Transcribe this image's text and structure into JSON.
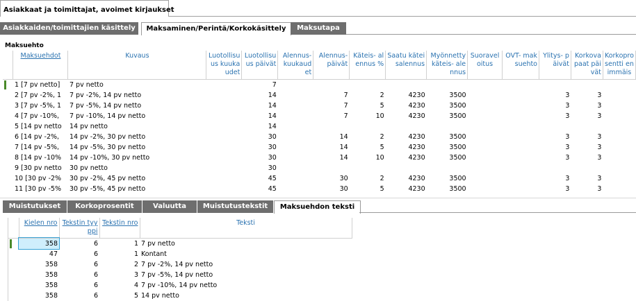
{
  "window": {
    "title": "Asiakkaat ja toimittajat, avoimet kirjaukset"
  },
  "top_tabs": [
    {
      "label": "Asiakkaiden/toimittajien käsittely",
      "active": false
    },
    {
      "label": "Maksaminen/Perintä/Korkokäsittely",
      "active": true
    },
    {
      "label": "Maksutapa",
      "active": false
    }
  ],
  "section_title": "Maksuehto",
  "grid1": {
    "columns": [
      "Maksuehdot",
      "Kuvaus",
      "Luotollisuus kuukaudet",
      "Luotollisuus päivät",
      "Alennus- kuukaudet",
      "Alennus- päivät",
      "Käteis- alennus %",
      "Saatu käteisalennus",
      "Myönnetty käteis- alennus",
      "Suoraveloitus",
      "OVT- maksuehto",
      "Ylitys- päivät",
      "Korkovapaat päivät",
      "Korkoprosentti enimmäis"
    ],
    "rows": [
      [
        "1 [7 pv netto]",
        "7 pv netto",
        "",
        "7",
        "",
        "",
        "",
        "",
        "",
        "",
        "",
        "",
        "",
        ""
      ],
      [
        "2 [7 pv -2%, 1",
        "7 pv -2%, 14 pv netto",
        "",
        "14",
        "",
        "7",
        "2",
        "4230",
        "3500",
        "",
        "",
        "3",
        "3",
        ""
      ],
      [
        "3 [7 pv -5%, 1",
        "7 pv -5%, 14 pv netto",
        "",
        "14",
        "",
        "7",
        "5",
        "4230",
        "3500",
        "",
        "",
        "3",
        "3",
        ""
      ],
      [
        "4 [7 pv -10%,",
        "7 pv -10%, 14 pv netto",
        "",
        "14",
        "",
        "7",
        "10",
        "4230",
        "3500",
        "",
        "",
        "3",
        "3",
        ""
      ],
      [
        "5 [14 pv netto",
        "14 pv netto",
        "",
        "14",
        "",
        "",
        "",
        "",
        "",
        "",
        "",
        "",
        "",
        ""
      ],
      [
        "6 [14 pv -2%,",
        "14 pv -2%, 30 pv netto",
        "",
        "30",
        "",
        "14",
        "2",
        "4230",
        "3500",
        "",
        "",
        "3",
        "3",
        ""
      ],
      [
        "7 [14 pv -5%,",
        "14 pv -5%, 30 pv netto",
        "",
        "30",
        "",
        "14",
        "5",
        "4230",
        "3500",
        "",
        "",
        "3",
        "3",
        ""
      ],
      [
        "8 [14 pv -10%",
        "14 pv -10%, 30 pv netto",
        "",
        "30",
        "",
        "14",
        "10",
        "4230",
        "3500",
        "",
        "",
        "3",
        "3",
        ""
      ],
      [
        "9 [30 pv netto",
        "30 pv netto",
        "",
        "30",
        "",
        "",
        "",
        "",
        "",
        "",
        "",
        "",
        "",
        ""
      ],
      [
        "10 [30 pv -2%",
        "30 pv -2%, 45 pv netto",
        "",
        "45",
        "",
        "30",
        "2",
        "4230",
        "3500",
        "",
        "",
        "3",
        "3",
        ""
      ],
      [
        "11 [30 pv -5%",
        "30 pv -5%, 45 pv netto",
        "",
        "45",
        "",
        "30",
        "5",
        "4230",
        "3500",
        "",
        "",
        "3",
        "3",
        ""
      ]
    ]
  },
  "bottom_tabs": [
    {
      "label": "Muistutukset",
      "active": false
    },
    {
      "label": "Korkoprosentit",
      "active": false
    },
    {
      "label": "Valuutta",
      "active": false
    },
    {
      "label": "Muistutustekstit",
      "active": false
    },
    {
      "label": "Maksuehdon teksti",
      "active": true
    }
  ],
  "grid2": {
    "columns": [
      "Kielen nro",
      "Tekstin tyyppi",
      "Tekstin nro",
      "Teksti"
    ],
    "rows": [
      [
        "358",
        "6",
        "1",
        "7 pv netto"
      ],
      [
        "47",
        "6",
        "1",
        "Kontant"
      ],
      [
        "358",
        "6",
        "2",
        "7 pv -2%, 14 pv netto"
      ],
      [
        "358",
        "6",
        "3",
        "7 pv -5%, 14 pv netto"
      ],
      [
        "358",
        "6",
        "4",
        "7 pv -10%, 14 pv netto"
      ],
      [
        "358",
        "6",
        "5",
        "14 pv netto"
      ]
    ]
  },
  "colors": {
    "header_text": "#2a72b0",
    "tab_inactive": "#6e6e6e",
    "row_indicator": "#4a8a2a",
    "selected_cell": "#cfeefc"
  }
}
